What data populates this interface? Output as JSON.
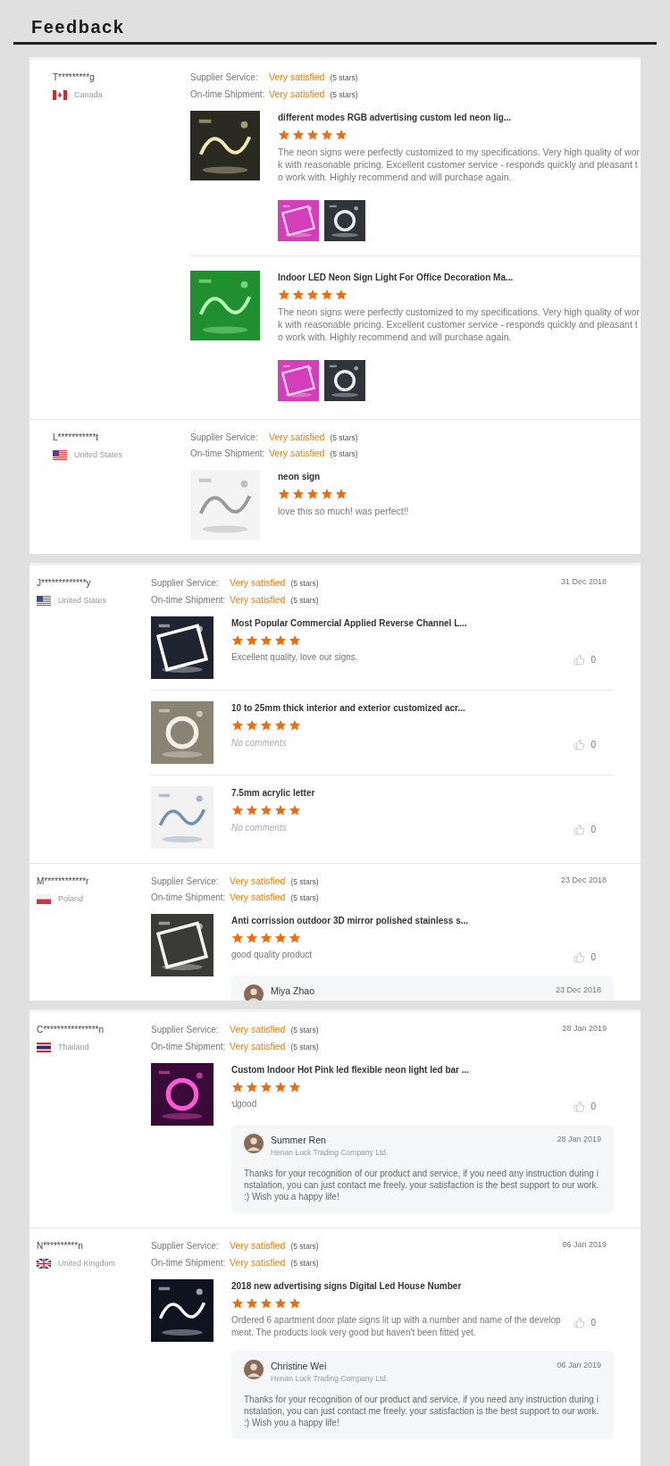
{
  "title": "Feedback",
  "panels": [
    {
      "reviews": [
        {
          "user": "T*********g",
          "flag": {
            "kind": "canada"
          },
          "country": "Canada",
          "ratings": [
            {
              "label": "Supplier Service:",
              "value": "Very satisfied",
              "note": "(5 stars)"
            },
            {
              "label": "On-time Shipment:",
              "value": "Very satisfied",
              "note": "(5 stars)"
            }
          ],
          "items": [
            {
              "title": "different modes RGB advertising custom led neon lig...",
              "stars": 5,
              "comment": {
                "kind": "text",
                "text": "The neon signs were perfectly customized to my specifications. Very high quality of work with reasonable pricing. Excellent customer service - responds quickly and pleasant to work with. Highly recommend and will purchase again."
              },
              "photos": [
                {
                  "kind": "picture"
                },
                {
                  "kind": "picture"
                }
              ]
            },
            {
              "title": "Indoor LED Neon Sign Light For Office Decoration Ma...",
              "stars": 5,
              "comment": {
                "kind": "text",
                "text": "The neon signs were perfectly customized to my specifications. Very high quality of work with reasonable pricing. Excellent customer service - responds quickly and pleasant to work with. Highly recommend and will purchase again."
              },
              "photos": [
                {
                  "kind": "picture"
                },
                {
                  "kind": "picture"
                }
              ]
            }
          ]
        },
        {
          "user": "L***********t",
          "flag": {
            "kind": "usa"
          },
          "country": "United States",
          "ratings": [
            {
              "label": "Supplier Service:",
              "value": "Very satisfied",
              "note": "(5 stars)"
            },
            {
              "label": "On-time Shipment:",
              "value": "Very satisfied",
              "note": "(5 stars)"
            }
          ],
          "items": [
            {
              "title": "neon sign",
              "stars": 5,
              "comment": {
                "kind": "text",
                "text": "love this so much! was perfect!!"
              }
            }
          ]
        }
      ]
    },
    {
      "reviews": [
        {
          "user": "J*************y",
          "flag": {
            "kind": "usa"
          },
          "country": "United States",
          "date": "31 Dec 2018",
          "ratings": [
            {
              "label": "Supplier Service:",
              "value": "Very satisfied",
              "note": "(5 stars)"
            },
            {
              "label": "On-time Shipment:",
              "value": "Very satisfied",
              "note": "(5 stars)"
            }
          ],
          "items": [
            {
              "title": "Most Popular Commercial Applied Reverse Channel L...",
              "stars": 5,
              "comment": {
                "kind": "text",
                "text": "Excellent quality, love our signs."
              },
              "likes": "0"
            },
            {
              "title": "10 to 25mm thick interior and exterior customized acr...",
              "stars": 5,
              "comment": {
                "kind": "empty",
                "text": "No comments"
              },
              "likes": "0"
            },
            {
              "title": "7.5mm acrylic letter",
              "stars": 5,
              "comment": {
                "kind": "empty",
                "text": "No comments"
              },
              "likes": "0"
            }
          ]
        },
        {
          "user": "M************r",
          "flag": {
            "kind": "poland"
          },
          "country": "Poland",
          "date": "23 Dec 2018",
          "ratings": [
            {
              "label": "Supplier Service:",
              "value": "Very satisfied",
              "note": "(5 stars)"
            },
            {
              "label": "On-time Shipment:",
              "value": "Very satisfied",
              "note": "(5 stars)"
            }
          ],
          "items": [
            {
              "title": "Anti corrission outdoor 3D mirror polished stainless s...",
              "stars": 5,
              "comment": {
                "kind": "text",
                "text": "good quality product"
              },
              "likes": "0",
              "reply": {
                "name": "Miya Zhao",
                "date": "23 Dec 2018"
              }
            }
          ]
        }
      ]
    },
    {
      "reviews": [
        {
          "user": "C****************n",
          "flag": {
            "kind": "thailand"
          },
          "country": "Thailand",
          "date": "28 Jan 2019",
          "ratings": [
            {
              "label": "Supplier Service:",
              "value": "Very satisfied",
              "note": "(5 stars)"
            },
            {
              "label": "On-time Shipment:",
              "value": "Very satisfied",
              "note": "(5 stars)"
            }
          ],
          "items": [
            {
              "title": "Custom Indoor Hot Pink led flexible neon light led bar ...",
              "stars": 5,
              "comment": {
                "kind": "text",
                "text": "ปgood"
              },
              "likes": "0",
              "reply": {
                "name": "Summer Ren",
                "company": "Henan Luck Trading Company Ltd.",
                "date": "28 Jan 2019",
                "text": "Thanks for your recognition of our product and service, if you need any instruction during instalation,  you can just contact me freely. your satisfaction is the best support to our work. :)  Wish you a happy life!"
              }
            }
          ]
        },
        {
          "user": "N**********n",
          "flag": {
            "kind": "uk"
          },
          "country": "United Kingdom",
          "date": "06 Jan 2019",
          "ratings": [
            {
              "label": "Supplier Service:",
              "value": "Very satisfied",
              "note": "(5 stars)"
            },
            {
              "label": "On-time Shipment:",
              "value": "Very satisfied",
              "note": "(5 stars)"
            }
          ],
          "items": [
            {
              "title": "2018 new advertising signs Digital Led House Number",
              "stars": 5,
              "comment": {
                "kind": "text",
                "text": "Ordered 6 apartment door plate signs lit up with a number and name of the development. The products look very good but haven't been fitted yet."
              },
              "likes": "0",
              "reply": {
                "name": "Christine Wei",
                "company": "Henan Luck Trading Company Ltd.",
                "date": "06 Jan 2019",
                "text": "Thanks for your recognition of our product and service, if you need any instruction during instalation,  you can just contact me freely. your satisfaction is the best support to our work. :)  Wish you a happy life!"
              }
            }
          ]
        }
      ]
    }
  ]
}
